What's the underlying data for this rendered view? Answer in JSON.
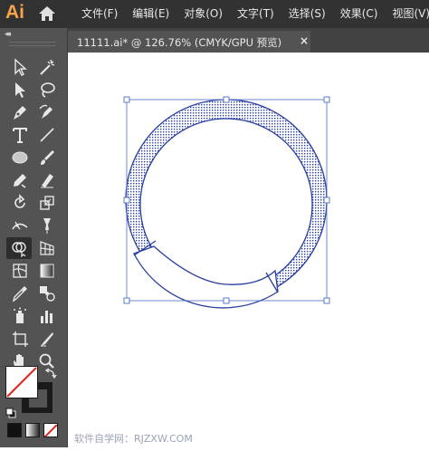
{
  "app": {
    "logo_text": "Ai"
  },
  "menu": [
    "文件(F)",
    "编辑(E)",
    "对象(O)",
    "文字(T)",
    "选择(S)",
    "效果(C)",
    "视图(V)"
  ],
  "toolbar": {
    "collapse_label": "◂◂",
    "tools": [
      "selection",
      "magic-wand",
      "direct-selection",
      "lasso",
      "pen",
      "curvature",
      "type",
      "line-segment",
      "ellipse",
      "paintbrush",
      "shaper",
      "eraser",
      "rotate",
      "scale",
      "width",
      "puppet-warp",
      "shape-builder",
      "perspective-grid",
      "mesh",
      "gradient",
      "eyedropper",
      "blend",
      "symbol-sprayer",
      "column-graph",
      "artboard",
      "slice",
      "hand",
      "zoom"
    ],
    "active_tool": "shape-builder"
  },
  "document_tab": {
    "title": "11111.ai* @ 126.76% (CMYK/GPU 预览)",
    "close_label": "×"
  },
  "canvas": {
    "watermark": "软件自学网：RJZXW.COM"
  },
  "colors": {
    "menubar_bg": "#323232",
    "panel_bg": "#535353",
    "logo": "#f7a44a",
    "selection_blue": "#4a6fc4",
    "path_blue": "#2a3fa0"
  }
}
